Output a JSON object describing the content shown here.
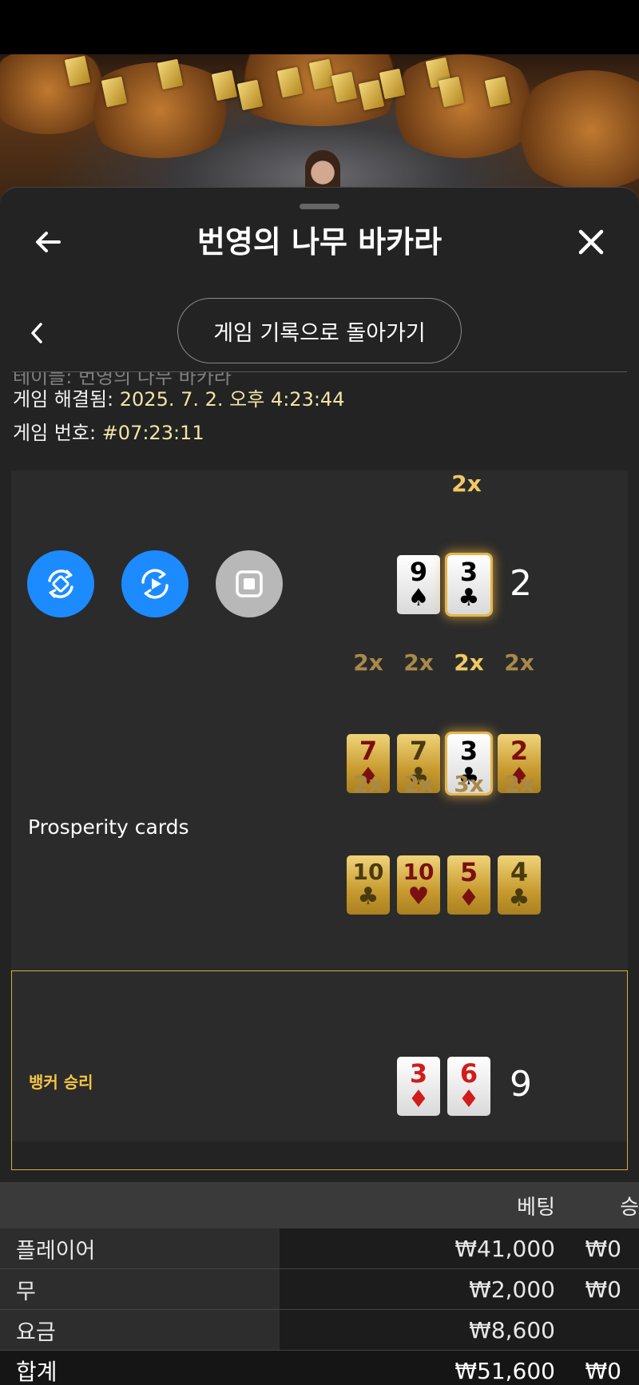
{
  "header": {
    "title": "번영의 나무 바카라",
    "back_icon": "arrow-left-icon",
    "close_icon": "close-icon"
  },
  "nav": {
    "history_button": "게임 기록으로 돌아가기",
    "prev_icon": "chevron-left-icon"
  },
  "info": {
    "table_label": "테이블:",
    "table_value": "번영의 나무 바카라",
    "resolved_label": "게임 해결됨:",
    "resolved_value": "2025. 7. 2. 오후 4:23:44",
    "game_number_label": "게임 번호:",
    "game_number_value": "#07:23:11"
  },
  "player_hand": {
    "cards": [
      {
        "rank": "9",
        "suit": "♠",
        "color": "black",
        "multiplier": ""
      },
      {
        "rank": "3",
        "suit": "♣",
        "color": "black",
        "multiplier": "2x",
        "highlighted": true
      }
    ],
    "score": "2"
  },
  "prosperity": {
    "label": "Prosperity cards",
    "row1": [
      {
        "rank": "7",
        "suit": "♦",
        "color": "red",
        "multiplier": "2x"
      },
      {
        "rank": "7",
        "suit": "♣",
        "color": "black",
        "multiplier": "2x"
      },
      {
        "rank": "3",
        "suit": "♣",
        "color": "black",
        "multiplier": "2x",
        "highlighted": true
      },
      {
        "rank": "2",
        "suit": "♦",
        "color": "red",
        "multiplier": "2x"
      }
    ],
    "row2": [
      {
        "rank": "10",
        "suit": "♣",
        "color": "black",
        "multiplier": "2x"
      },
      {
        "rank": "10",
        "suit": "♥",
        "color": "red",
        "multiplier": "2x"
      },
      {
        "rank": "5",
        "suit": "♦",
        "color": "red",
        "multiplier": "3x"
      },
      {
        "rank": "4",
        "suit": "♣",
        "color": "black",
        "multiplier": "2x"
      }
    ]
  },
  "banker_hand": {
    "result_label": "뱅커 승리",
    "cards": [
      {
        "rank": "3",
        "suit": "♦",
        "color": "red"
      },
      {
        "rank": "6",
        "suit": "♦",
        "color": "red"
      }
    ],
    "score": "9"
  },
  "controls": {
    "replay_icon": "rotate-diamond-icon",
    "play_icon": "replay-play-icon",
    "stop_icon": "stop-icon"
  },
  "table": {
    "headers": {
      "bet": "베팅",
      "win": "승"
    },
    "rows": [
      {
        "label": "플레이어",
        "bet": "₩41,000",
        "win": "₩0"
      },
      {
        "label": "무",
        "bet": "₩2,000",
        "win": "₩0"
      },
      {
        "label": "요금",
        "bet": "₩8,600",
        "win": ""
      }
    ],
    "total": {
      "label": "합계",
      "bet": "₩51,600",
      "win": "₩0"
    }
  },
  "colors": {
    "accent_blue": "#1c8bff",
    "gold": "#d4b13d",
    "value_text": "#f3e4a6",
    "win_label": "#f5c542"
  }
}
